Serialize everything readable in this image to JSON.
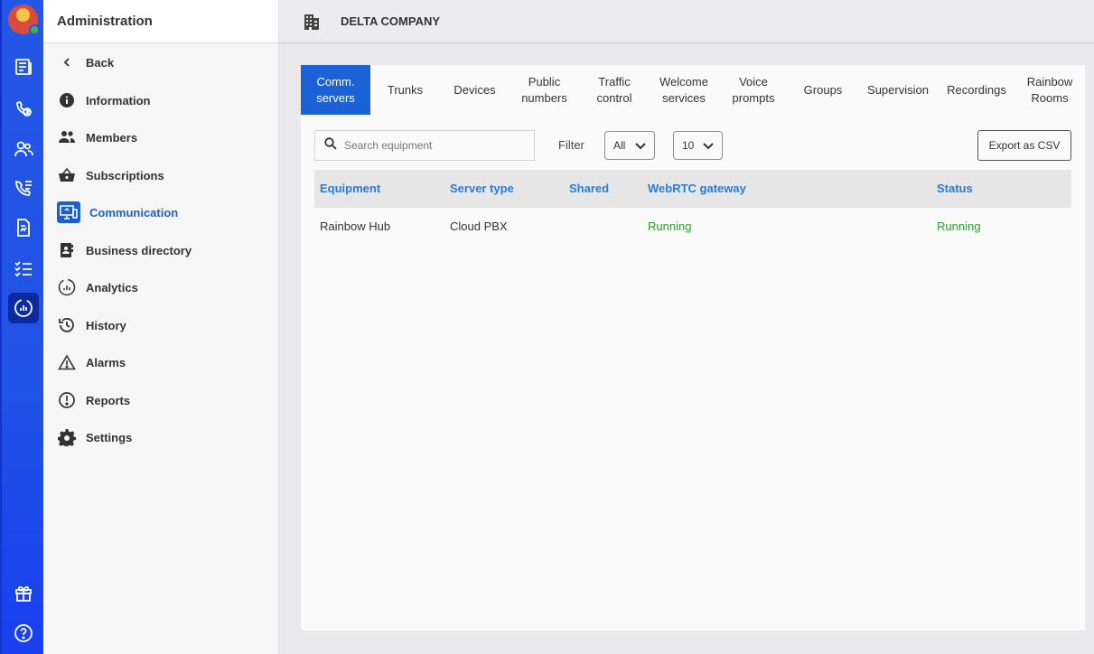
{
  "rail": {
    "icons": [
      "avatar",
      "newspaper-icon",
      "phone-clock-icon",
      "users-icon",
      "call-list-icon",
      "document-icon",
      "checklist-icon",
      "analytics-gauge-icon",
      "gift-icon",
      "help-icon"
    ]
  },
  "sidebar": {
    "title": "Administration",
    "back_label": "Back",
    "items": [
      {
        "label": "Information",
        "icon": "info-icon"
      },
      {
        "label": "Members",
        "icon": "members-icon"
      },
      {
        "label": "Subscriptions",
        "icon": "basket-icon"
      },
      {
        "label": "Communication",
        "icon": "communication-icon",
        "active": true
      },
      {
        "label": "Business directory",
        "icon": "directory-icon"
      },
      {
        "label": "Analytics",
        "icon": "analytics-icon"
      },
      {
        "label": "History",
        "icon": "history-icon"
      },
      {
        "label": "Alarms",
        "icon": "warning-icon"
      },
      {
        "label": "Reports",
        "icon": "report-icon"
      },
      {
        "label": "Settings",
        "icon": "gear-icon"
      }
    ]
  },
  "topbar": {
    "company": "DELTA COMPANY"
  },
  "tabs": [
    {
      "label": "Comm.\nservers",
      "active": true
    },
    {
      "label": "Trunks"
    },
    {
      "label": "Devices"
    },
    {
      "label": "Public\nnumbers"
    },
    {
      "label": "Traffic\ncontrol"
    },
    {
      "label": "Welcome\nservices"
    },
    {
      "label": "Voice\nprompts"
    },
    {
      "label": "Groups"
    },
    {
      "label": "Supervision"
    },
    {
      "label": "Recordings"
    },
    {
      "label": "Rainbow\nRooms"
    }
  ],
  "toolbar": {
    "search_placeholder": "Search equipment",
    "filter_label": "Filter",
    "filter_value": "All",
    "page_size_value": "10",
    "export_label": "Export as CSV"
  },
  "table": {
    "headers": [
      "Equipment",
      "Server type",
      "Shared",
      "WebRTC gateway",
      "Status"
    ],
    "rows": [
      [
        "Rainbow Hub",
        "Cloud PBX",
        "",
        "Running",
        "Running"
      ]
    ]
  },
  "colors": {
    "rail": "#2457e6",
    "accent": "#1b62d6",
    "header_text": "#2b7ad8",
    "running": "#2aa02a"
  }
}
